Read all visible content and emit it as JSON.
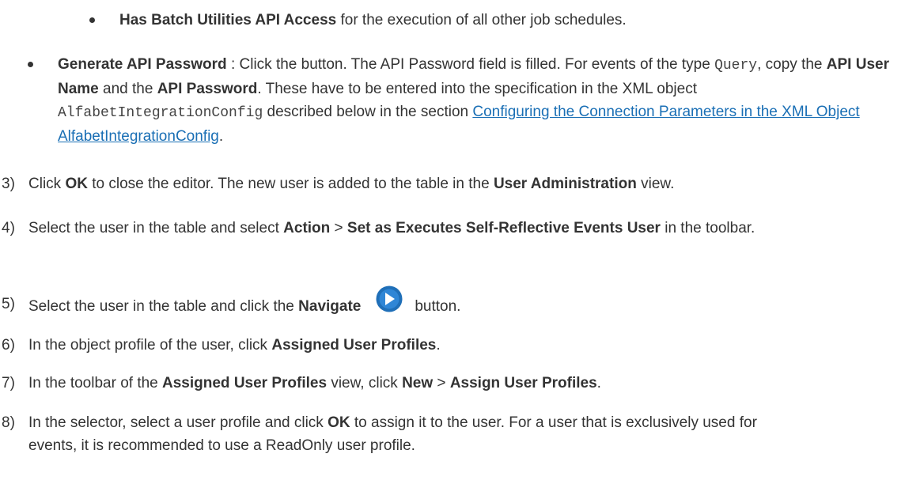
{
  "b1": {
    "bold": "Has Batch Utilities API Access",
    "rest": " for the execution of all other job schedules."
  },
  "b2": {
    "bold1": "Generate API Password",
    "t1": " : Click the button. The API Password field is filled. For events of the type ",
    "code1": "Query",
    "t2": ", copy the ",
    "bold2": "API User Name",
    "t3": " and the ",
    "bold3": "API Password",
    "t4": ". These have to be entered into the specification in the XML object ",
    "code2": "AlfabetIntegrationConfig",
    "t5": " described below in the section ",
    "link": "Configuring the Connection Parameters in the XML Object AlfabetIntegrationConfig",
    "t6": "."
  },
  "s3": {
    "num": "3)",
    "t1": "Click ",
    "b1": "OK",
    "t2": " to close the editor. The new user is added to the table in the ",
    "b2": "User Administration",
    "t3": " view."
  },
  "s4": {
    "num": "4)",
    "t1": "Select the user in the table and select ",
    "b1": "Action",
    "t2": " > ",
    "b2": "Set as Executes Self-Reflective Events User",
    "t3": " in the toolbar."
  },
  "s5": {
    "num": "5)",
    "t1": "Select the user in the table and click the ",
    "b1": "Navigate",
    "t2": "button."
  },
  "s6": {
    "num": "6)",
    "t1": "In the object profile of the user, click ",
    "b1": "Assigned User Profiles",
    "t2": "."
  },
  "s7": {
    "num": "7)",
    "t1": "In the toolbar of the ",
    "b1": "Assigned User Profiles",
    "t2": " view, click ",
    "b2": "New",
    "t3": " > ",
    "b3": "Assign User Profiles",
    "t4": "."
  },
  "s8": {
    "num": "8)",
    "t1": "In the selector, select a user profile and click ",
    "b1": "OK",
    "t2": " to assign it to the user. For a user that is exclusively used for events, it is recommended to use a ReadOnly user profile."
  },
  "icons": {
    "navigate": "navigate-arrow-icon"
  },
  "colors": {
    "link": "#1a6fb5",
    "icon": "#1f6fb8"
  }
}
